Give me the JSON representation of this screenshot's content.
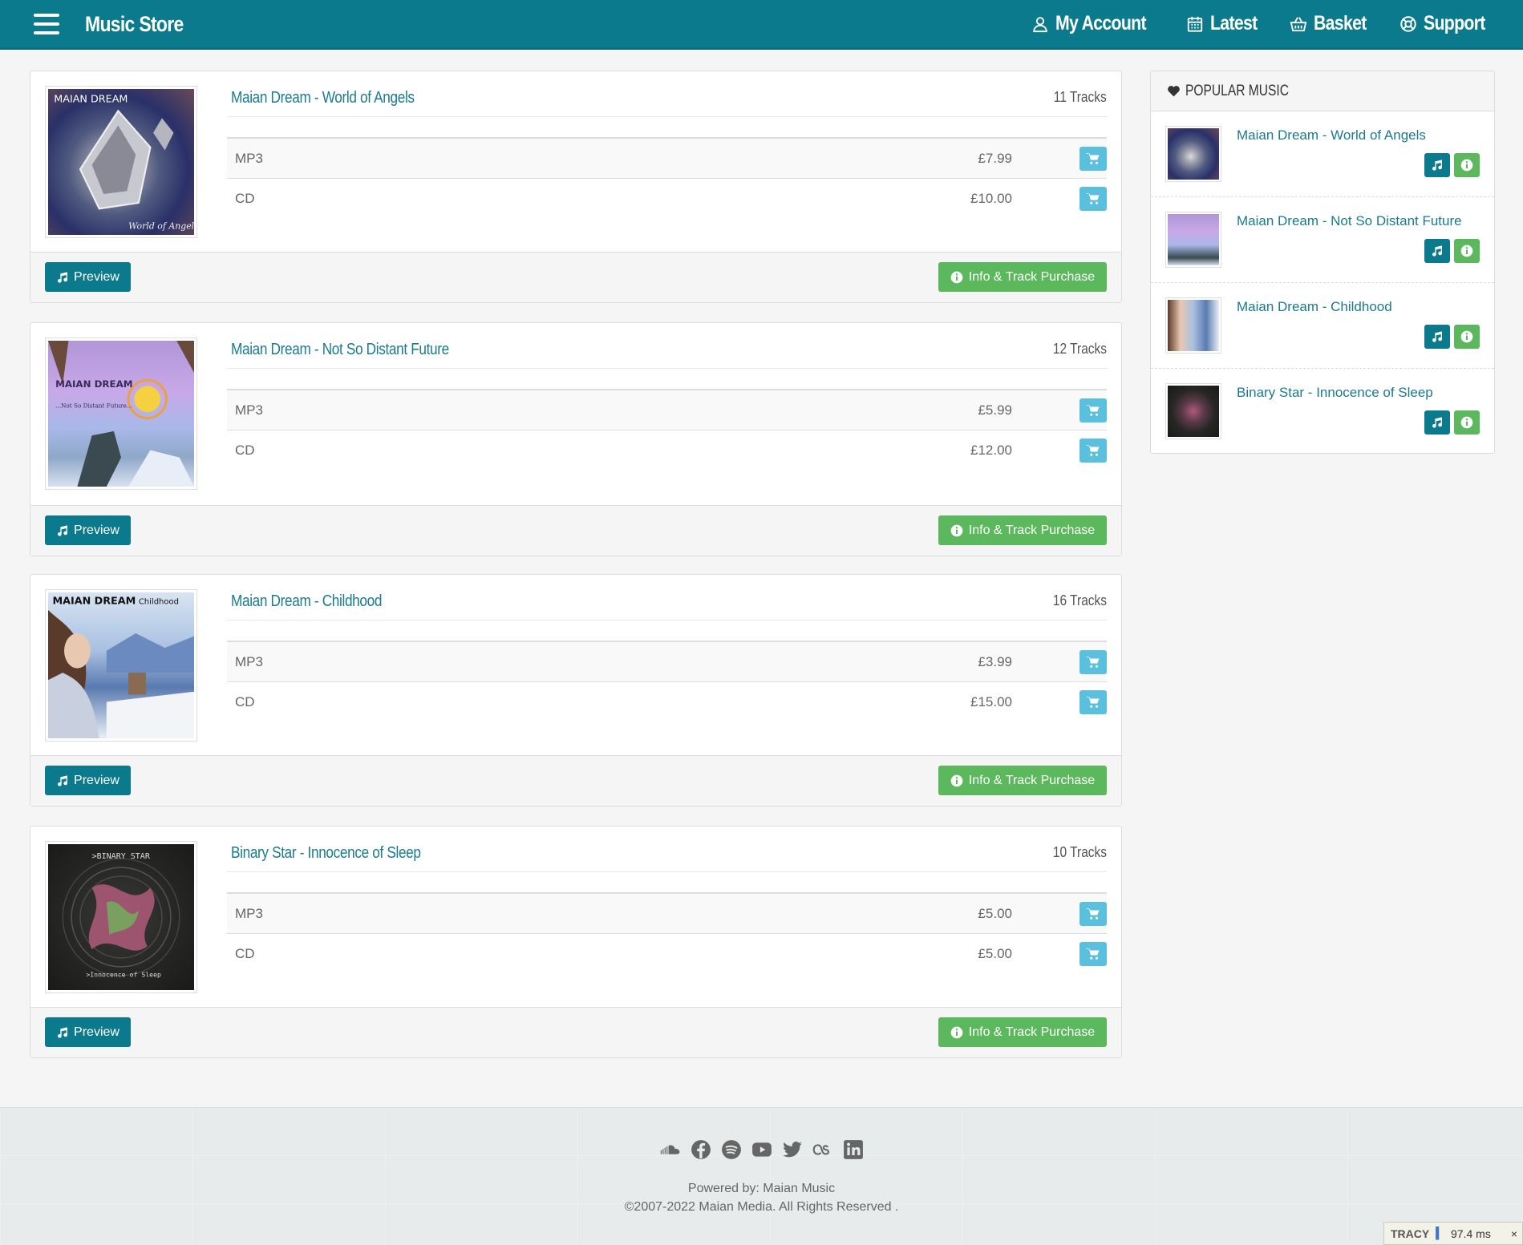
{
  "header": {
    "brand": "Music Store",
    "nav": [
      {
        "label": "My Account",
        "icon": "user-icon"
      },
      {
        "label": "Latest",
        "icon": "calendar-icon"
      },
      {
        "label": "Basket",
        "icon": "basket-icon"
      },
      {
        "label": "Support",
        "icon": "lifebuoy-icon"
      }
    ],
    "colors": {
      "primary": "#0b7a8c",
      "success": "#5cb85c",
      "cart": "#5bc0de",
      "link": "#1a7a90"
    }
  },
  "albums": [
    {
      "title": "Maian Dream - World of Angels",
      "tracks": "11 Tracks",
      "cover_text_top": "MAIAN DREAM",
      "cover_text_bottom": "World of Angels",
      "formats": [
        {
          "name": "MP3",
          "price": "£7.99"
        },
        {
          "name": "CD",
          "price": "£10.00"
        }
      ],
      "preview_label": "Preview",
      "info_label": "Info & Track Purchase"
    },
    {
      "title": "Maian Dream - Not So Distant Future",
      "tracks": "12 Tracks",
      "cover_text_top": "MAIAN DREAM",
      "cover_text_bottom": "...Not So Distant Future...",
      "formats": [
        {
          "name": "MP3",
          "price": "£5.99"
        },
        {
          "name": "CD",
          "price": "£12.00"
        }
      ],
      "preview_label": "Preview",
      "info_label": "Info & Track Purchase"
    },
    {
      "title": "Maian Dream - Childhood",
      "tracks": "16 Tracks",
      "cover_text_top": "MAIAN DREAM",
      "cover_text_bottom": "Childhood",
      "formats": [
        {
          "name": "MP3",
          "price": "£3.99"
        },
        {
          "name": "CD",
          "price": "£15.00"
        }
      ],
      "preview_label": "Preview",
      "info_label": "Info & Track Purchase"
    },
    {
      "title": "Binary Star - Innocence of Sleep",
      "tracks": "10 Tracks",
      "cover_text_top": ">BINARY STAR",
      "cover_text_bottom": ">Innocence of Sleep",
      "formats": [
        {
          "name": "MP3",
          "price": "£5.00"
        },
        {
          "name": "CD",
          "price": "£5.00"
        }
      ],
      "preview_label": "Preview",
      "info_label": "Info & Track Purchase"
    }
  ],
  "popular": {
    "heading": "POPULAR MUSIC",
    "items": [
      {
        "title": "Maian Dream - World of Angels"
      },
      {
        "title": "Maian Dream - Not So Distant Future"
      },
      {
        "title": "Maian Dream - Childhood"
      },
      {
        "title": "Binary Star - Innocence of Sleep"
      }
    ]
  },
  "footer": {
    "social": [
      "soundcloud-icon",
      "facebook-icon",
      "spotify-icon",
      "youtube-icon",
      "twitter-icon",
      "lastfm-icon",
      "linkedin-icon"
    ],
    "powered": "Powered by: Maian Music",
    "copyright": "©2007-2022 Maian Media. All Rights Reserved ."
  },
  "tracy": {
    "label": "TRACY",
    "time": "97.4 ms",
    "close": "×"
  }
}
